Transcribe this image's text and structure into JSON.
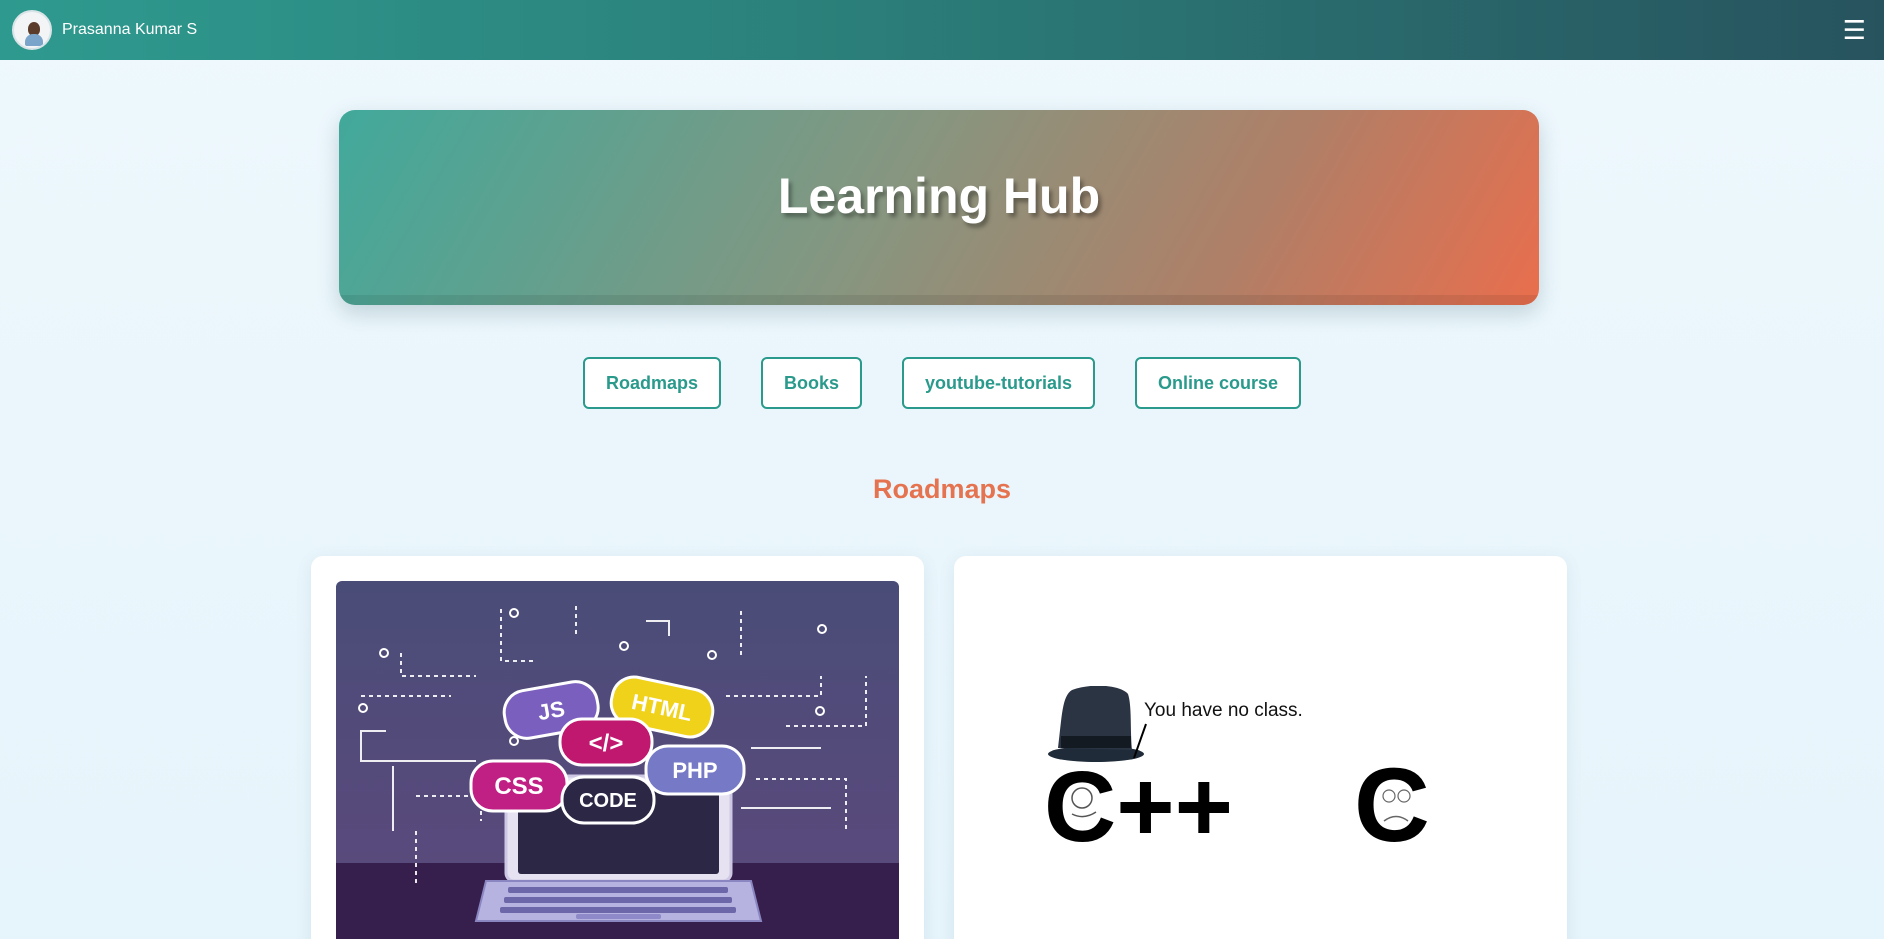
{
  "navbar": {
    "user_name": "Prasanna Kumar S",
    "menu_icon": "☰"
  },
  "hero": {
    "title": "Learning Hub"
  },
  "categories": [
    {
      "label": "Roadmaps"
    },
    {
      "label": "Books"
    },
    {
      "label": "youtube-tutorials"
    },
    {
      "label": "Online course"
    }
  ],
  "section": {
    "title": "Roadmaps"
  },
  "cards": [
    {
      "image": "web-development-illustration",
      "bubbles": [
        "JS",
        "HTML",
        "</>",
        "PHP",
        "CSS",
        "CODE"
      ]
    },
    {
      "image": "cpp-vs-c-meme",
      "caption": "You have no class.",
      "left_text": "C++",
      "right_text": "C"
    }
  ],
  "colors": {
    "accent": "#2a9a8c",
    "section_title": "#e5734f",
    "hero_start": "#41a99b",
    "hero_end": "#e96e4d"
  }
}
